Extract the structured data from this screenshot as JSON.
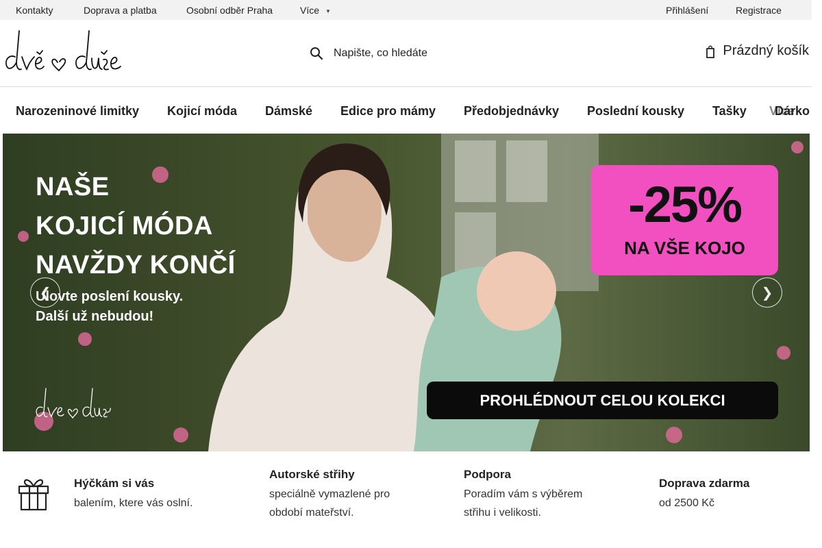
{
  "topbar": {
    "links": [
      "Kontakty",
      "Doprava a platba",
      "Osobní odběr Praha",
      "Více"
    ],
    "more_icon": "chevron-down-icon",
    "login": "Přihlášení",
    "register": "Registrace"
  },
  "header": {
    "logo_text": "dvě srdce duše",
    "search_placeholder": "Napište, co hledáte",
    "search_icon": "search-icon",
    "cart_label": "Prázdný košík",
    "cart_icon": "cart-icon"
  },
  "nav": {
    "items": [
      "Narozeninové limitky",
      "Kojicí móda",
      "Dámské",
      "Edice pro mámy",
      "Předobjednávky",
      "Poslední kousky",
      "Tašky",
      "Dárko",
      "Více"
    ]
  },
  "banner": {
    "headline": [
      "NAŠE",
      "KOJICÍ MÓDA",
      "NAVŽDY KONČÍ"
    ],
    "subline": [
      "Ulovte poslení kousky.",
      "Další už nebudou!"
    ],
    "badge_big": "-25%",
    "badge_small": "NA VŠE KOJO",
    "cta": "PROHLÉDNOUT CELOU KOLEKCI",
    "prev_icon": "chevron-left-icon",
    "next_icon": "chevron-right-icon",
    "colors": {
      "badge": "#f24fc1",
      "cta": "#0b0b0b"
    }
  },
  "benefits": [
    {
      "icon": "gift-icon",
      "title": "Hýčkám si vás",
      "text": [
        "balením, ktere vás oslní."
      ]
    },
    {
      "title": "Autorské střihy",
      "text": [
        "speciálně vymazlené pro",
        "období mateřství."
      ]
    },
    {
      "title": "Podpora",
      "text": [
        "Poradím vám s výběrem",
        "střihu i velikosti."
      ]
    },
    {
      "title": "Doprava zdarma",
      "text": [
        "od 2500 Kč"
      ]
    }
  ]
}
